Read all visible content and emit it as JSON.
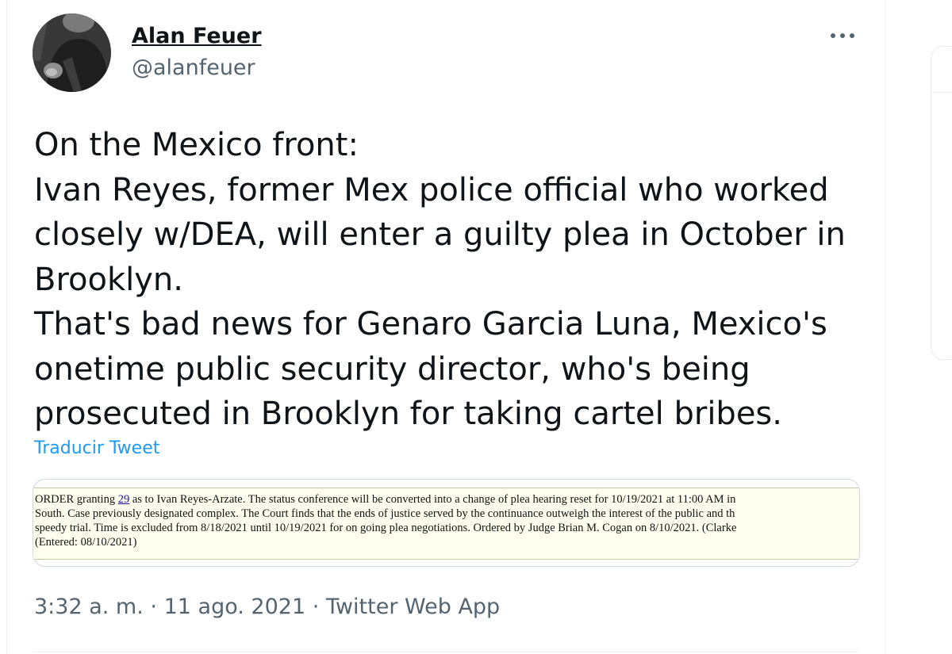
{
  "tweet": {
    "author": {
      "name": "Alan Feuer",
      "handle": "@alanfeuer"
    },
    "text_lines": [
      "On the Mexico front:",
      "Ivan Reyes, former Mex police official who worked",
      "closely w/DEA, will enter a guilty plea in October in",
      "Brooklyn.",
      "That's bad news for Genaro Garcia Luna, Mexico's",
      "onetime public security director, who's being",
      "prosecuted in Brooklyn for taking cartel bribes."
    ],
    "translate_label": "Traducir Tweet",
    "attachment": {
      "line1_prefix": "ORDER granting ",
      "line1_link": "29",
      "line1_suffix": " as to Ivan Reyes-Arzate. The status conference will be converted into a change of plea hearing reset for 10/19/2021 at 11:00 AM in",
      "line2": "South. Case previously designated complex. The Court finds that the ends of justice served by the continuance outweigh the interest of the public and th",
      "line3": "speedy trial. Time is excluded from 8/18/2021 until 10/19/2021 for on going plea negotiations. Ordered by Judge Brian M. Cogan on 8/10/2021. (Clarke",
      "line4": "(Entered: 08/10/2021)"
    },
    "meta": {
      "time": "3:32 a. m.",
      "separator": "·",
      "date": "11 ago. 2021",
      "source": "Twitter Web App"
    }
  },
  "icons": {
    "more": "more-options-icon",
    "avatar": "avatar-photo"
  },
  "colors": {
    "link": "#1d9bf0",
    "secondary_text": "#536471",
    "primary_text": "#0f1419",
    "document_background": "#fffff0"
  }
}
